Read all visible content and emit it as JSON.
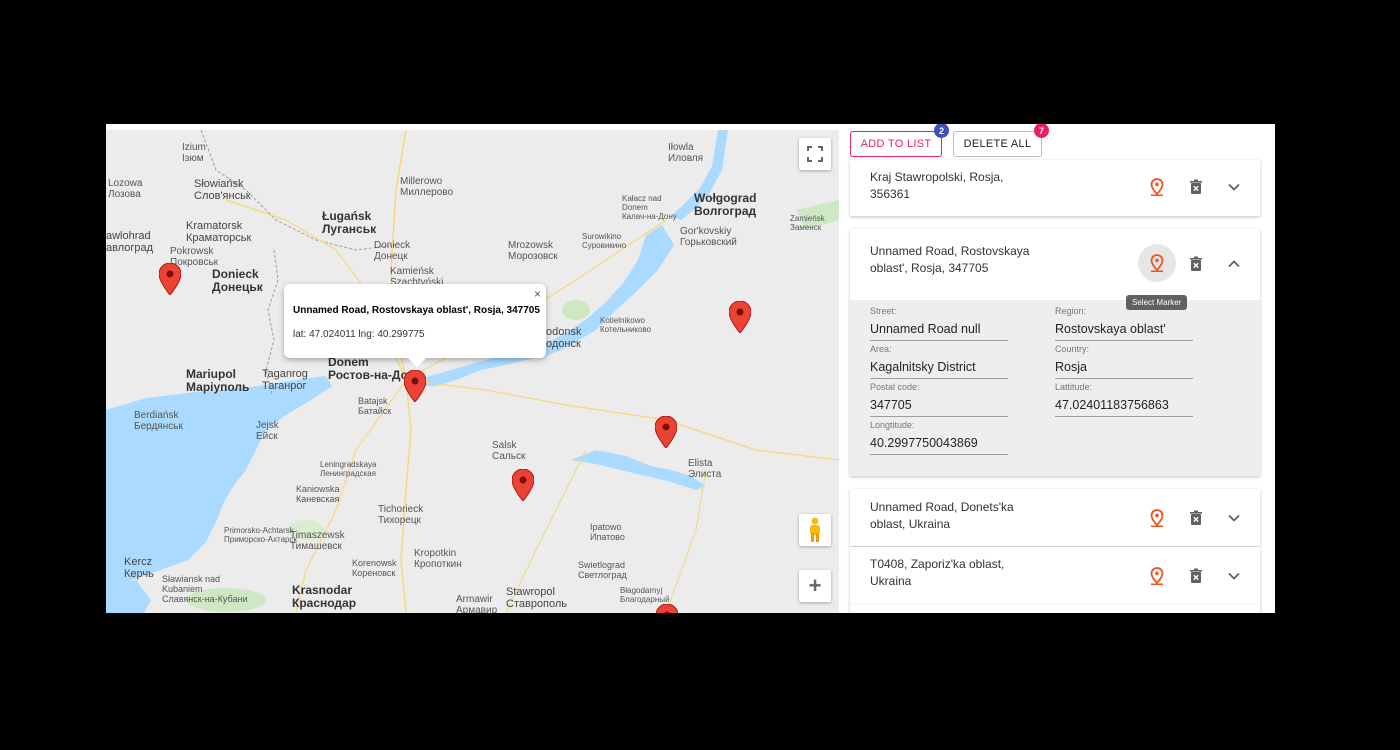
{
  "map": {
    "cities": [
      {
        "id": "izium",
        "text": "Izium\nІзюм"
      },
      {
        "id": "lozova",
        "text": "Lozowa\nЛозова"
      },
      {
        "id": "slowiansk",
        "text": "Słowiańsk\nСлов'янськ"
      },
      {
        "id": "kramatorsk",
        "text": "Kramatorsk\nКраматорськ"
      },
      {
        "id": "pokrovsk",
        "text": "Pokrowsk\nПокровськ"
      },
      {
        "id": "pavlohrad",
        "text": "awlohrad\nавлоград"
      },
      {
        "id": "doniek",
        "text": "Donieck\nДонецьк"
      },
      {
        "id": "lugansk",
        "text": "Ługańsk\nЛуганськ"
      },
      {
        "id": "millerowo",
        "text": "Millerowo\nМиллерово"
      },
      {
        "id": "doniecksmall",
        "text": "Donieck\nДонецк"
      },
      {
        "id": "kamiensk",
        "text": "Kamieńsk\nSzachtyński"
      },
      {
        "id": "mrozowsk",
        "text": "Mrozowsk\nМорозовск"
      },
      {
        "id": "kalacz",
        "text": "Kałacz nad\nDonem\nКалач-на-Дону"
      },
      {
        "id": "wolgograd",
        "text": "Wołgograd\nВолгоград"
      },
      {
        "id": "surowikino",
        "text": "Surowikino\nСуровикино"
      },
      {
        "id": "gorkovskiy",
        "text": "Gor'kovskiy\nГорьковский"
      },
      {
        "id": "zamiensk",
        "text": "Zamieńsk\nЗаменск"
      },
      {
        "id": "iłowla",
        "text": "Iłowla\nИловля"
      },
      {
        "id": "mariupol",
        "text": "Mariupol\nМаріуполь"
      },
      {
        "id": "taganrog",
        "text": "Taganrog\nТаганрог"
      },
      {
        "id": "rostov",
        "text": "Donem\nРостов-на-Дону"
      },
      {
        "id": "wolgodonsk",
        "text": "odonsk\nодонск"
      },
      {
        "id": "kotelnikowo",
        "text": "Kotielnikowo\nКотельниково"
      },
      {
        "id": "berdiansk",
        "text": "Berdiańsk\nБердянськ"
      },
      {
        "id": "jejsk",
        "text": "Jejsk\nЕйск"
      },
      {
        "id": "batajsk",
        "text": "Batajsk\nБатайск"
      },
      {
        "id": "salsk",
        "text": "Salsk\nСальск"
      },
      {
        "id": "elista",
        "text": "Elista\nЭлиста"
      },
      {
        "id": "leningradskaya",
        "text": "Leningradskaya\nЛенинградская"
      },
      {
        "id": "kaniowska",
        "text": "Kaniowska\nКаневская"
      },
      {
        "id": "primorsko",
        "text": "Primorsko-Achtarsk\nПриморско-Ахтарск"
      },
      {
        "id": "tichorieck",
        "text": "Tichorieck\nТихорецк"
      },
      {
        "id": "ipatowo",
        "text": "Ipatowo\nИпатово"
      },
      {
        "id": "timaszewsk",
        "text": "Timaszewsk\nТимашевск"
      },
      {
        "id": "korenowsk",
        "text": "Korenowsk\nКореновск"
      },
      {
        "id": "kropotkin",
        "text": "Kropotkin\nКропоткин"
      },
      {
        "id": "swietlograd",
        "text": "Swietlograd\nСветлоград"
      },
      {
        "id": "kercz",
        "text": "Kercz\nКерчь"
      },
      {
        "id": "slawiansk",
        "text": "Sławiansk nad\nKubaniem\nСлавянск-на-Кубани"
      },
      {
        "id": "krasnodar",
        "text": "Krasnodar\nКраснодар"
      },
      {
        "id": "armawir",
        "text": "Armawir\nАрмавир"
      },
      {
        "id": "stawropol",
        "text": "Stawropol\nСтаврополь"
      },
      {
        "id": "blagodarny",
        "text": "Błagodarnyj\nБлагодарный"
      }
    ],
    "infowindow": {
      "title": "Unnamed Road, Rostovskaya oblast', Rosja, 347705",
      "coords": "lat: 47.024011 lng: 40.299775",
      "close": "×"
    },
    "zoom_in": "+"
  },
  "toolbar": {
    "add_label": "ADD TO LIST",
    "add_badge": "2",
    "delete_label": "DELETE ALL",
    "delete_badge": "7"
  },
  "list": [
    {
      "address": "Kraj Stawropolski, Rosja, 356361",
      "expanded": false
    },
    {
      "address": "Unnamed Road, Rostovskaya oblast', Rosja, 347705",
      "expanded": true,
      "tooltip": "Select Marker",
      "details": {
        "street_label": "Street:",
        "street": "Unnamed Road null",
        "region_label": "Region:",
        "region": "Rostovskaya oblast'",
        "area_label": "Area:",
        "area": "Kagalnitsky District",
        "country_label": "Country:",
        "country": "Rosja",
        "postal_label": "Postal code:",
        "postal": "347705",
        "lat_label": "Lattitude:",
        "lat": "47.02401183756863",
        "lng_label": "Longtitude:",
        "lng": "40.2997750043869"
      }
    },
    {
      "address": "Unnamed Road, Donets'ka oblast, Ukraina",
      "expanded": false
    },
    {
      "address": "T0408, Zaporiz'ka oblast, Ukraina",
      "expanded": false
    }
  ],
  "colors": {
    "accent": "#e91e63",
    "badge_blue": "#3f51b5",
    "pin": "#ea4335",
    "marker_icon": "#f4511e"
  }
}
